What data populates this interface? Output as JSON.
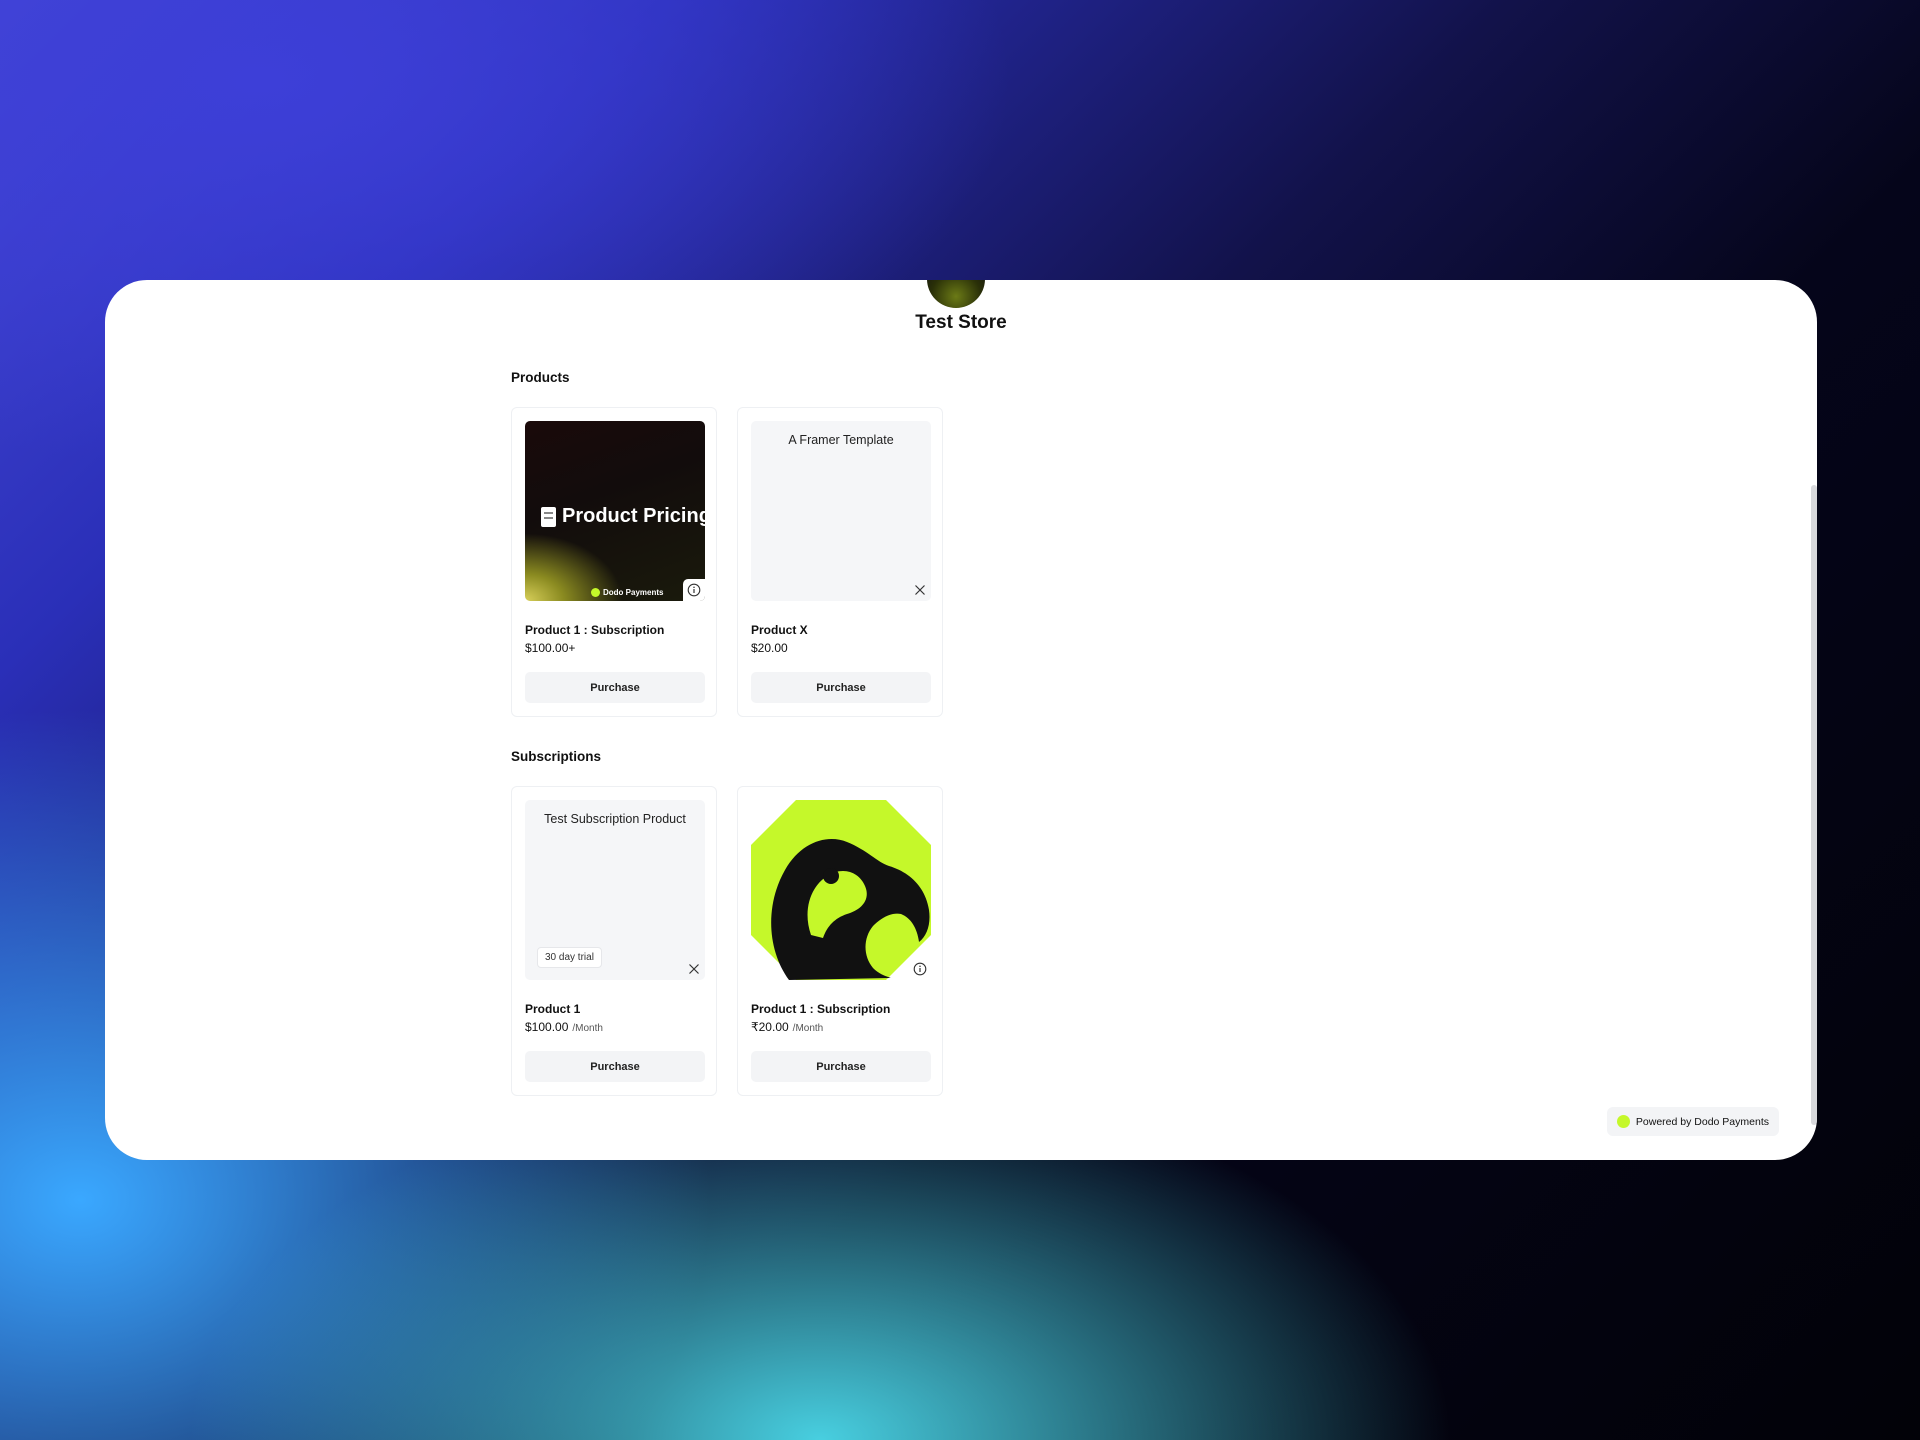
{
  "store": {
    "name": "Test Store"
  },
  "sections": {
    "products_title": "Products",
    "subscriptions_title": "Subscriptions"
  },
  "products": [
    {
      "name": "Product 1 : Subscription",
      "price": "$100.00+",
      "image_text": "Product Pricing",
      "image_brand": "Dodo Payments",
      "button": "Purchase",
      "corner_icon": "info-icon"
    },
    {
      "name": "Product X",
      "price": "$20.00",
      "image_text": "A Framer Template",
      "button": "Purchase",
      "corner_icon": "close-icon"
    }
  ],
  "subscriptions": [
    {
      "name": "Product 1",
      "price": "$100.00",
      "period": "/Month",
      "image_text": "Test Subscription Product",
      "badge": "30 day trial",
      "button": "Purchase",
      "corner_icon": "close-icon"
    },
    {
      "name": "Product 1 : Subscription",
      "price": "₹20.00",
      "period": "/Month",
      "button": "Purchase",
      "corner_icon": "info-icon"
    }
  ],
  "footer": {
    "powered_by": "Powered by Dodo Payments"
  },
  "colors": {
    "accent_lime": "#c5f82a",
    "card_bg": "#ffffff",
    "button_bg": "#f3f4f6"
  }
}
